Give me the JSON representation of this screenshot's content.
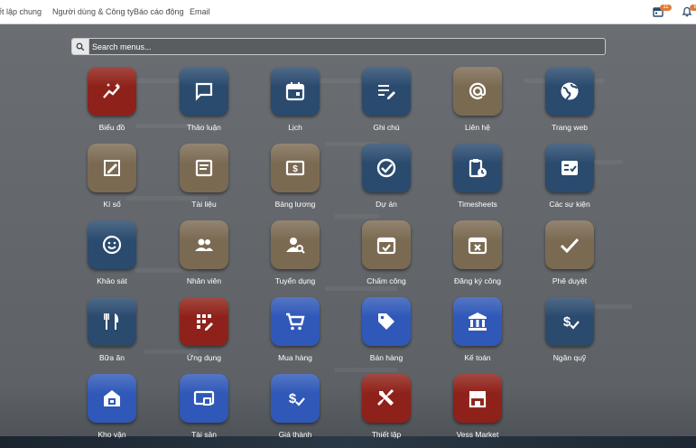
{
  "topbar": {
    "menus": [
      "ết lập chung",
      "Người dùng & Công ty",
      "Báo cáo động",
      "Email"
    ],
    "calendar_badge": "11",
    "bell_badge": "6"
  },
  "search": {
    "placeholder": "Search menus..."
  },
  "colors": {
    "red": "#8e2119",
    "navy": "#2a4a6e",
    "brown": "#7b6a52",
    "blue": "#2f58b8",
    "calendar_badge": "#e07b39",
    "bell_badge": "#e07b39"
  },
  "apps": [
    {
      "label": "Biểu đồ",
      "icon": "chart-icon",
      "color": "red"
    },
    {
      "label": "Thảo luận",
      "icon": "chat-icon",
      "color": "navy"
    },
    {
      "label": "Lịch",
      "icon": "calendar-icon",
      "color": "navy"
    },
    {
      "label": "Ghi chú",
      "icon": "note-icon",
      "color": "navy"
    },
    {
      "label": "Liên hệ",
      "icon": "at-icon",
      "color": "brown"
    },
    {
      "label": "Trang web",
      "icon": "globe-icon",
      "color": "navy"
    },
    {
      "label": "Kí số",
      "icon": "signature-icon",
      "color": "brown"
    },
    {
      "label": "Tài liệu",
      "icon": "document-icon",
      "color": "brown"
    },
    {
      "label": "Bảng lương",
      "icon": "payslip-icon",
      "color": "brown"
    },
    {
      "label": "Dự án",
      "icon": "check-circle-icon",
      "color": "navy"
    },
    {
      "label": "Timesheets",
      "icon": "clipboard-clock-icon",
      "color": "navy"
    },
    {
      "label": "Các sự kiện",
      "icon": "event-check-icon",
      "color": "navy"
    },
    {
      "label": "Khảo sát",
      "icon": "smile-icon",
      "color": "navy"
    },
    {
      "label": "Nhân viên",
      "icon": "people-icon",
      "color": "brown"
    },
    {
      "label": "Tuyển dụng",
      "icon": "person-search-icon",
      "color": "brown"
    },
    {
      "label": "Chấm công",
      "icon": "calendar-check-icon",
      "color": "brown"
    },
    {
      "label": "Đăng ký công",
      "icon": "calendar-x-icon",
      "color": "brown"
    },
    {
      "label": "Phê duyệt",
      "icon": "checkmark-icon",
      "color": "brown"
    },
    {
      "label": "Bữa ăn",
      "icon": "utensils-icon",
      "color": "navy"
    },
    {
      "label": "Ứng dụng",
      "icon": "app-grid-icon",
      "color": "red"
    },
    {
      "label": "Mua hàng",
      "icon": "cart-icon",
      "color": "blue"
    },
    {
      "label": "Bán hàng",
      "icon": "tag-icon",
      "color": "blue"
    },
    {
      "label": "Kế toán",
      "icon": "bank-icon",
      "color": "blue"
    },
    {
      "label": "Ngân quỹ",
      "icon": "money-check-icon",
      "color": "navy"
    },
    {
      "label": "Kho vận",
      "icon": "warehouse-icon",
      "color": "blue"
    },
    {
      "label": "Tài sản",
      "icon": "assets-icon",
      "color": "blue"
    },
    {
      "label": "Giá thành",
      "icon": "cost-icon",
      "color": "blue"
    },
    {
      "label": "Thiết lập",
      "icon": "tools-icon",
      "color": "red"
    },
    {
      "label": "Vess Market",
      "icon": "store-icon",
      "color": "red"
    }
  ]
}
